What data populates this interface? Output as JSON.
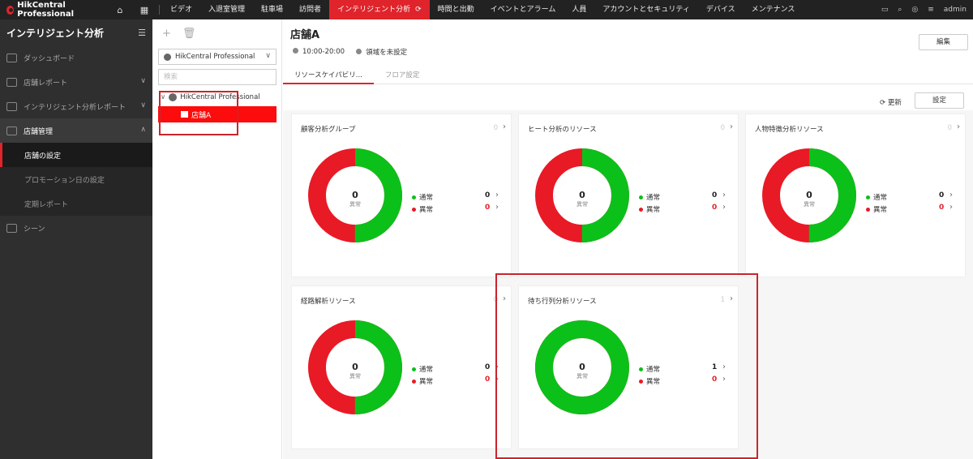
{
  "app": {
    "name": "HikCentral Professional",
    "user": "admin"
  },
  "nav": [
    "ビデオ",
    "入退室管理",
    "駐車場",
    "訪問者",
    "インテリジェント分析",
    "時間と出勤",
    "イベントとアラーム",
    "人員",
    "アカウントとセキュリティ",
    "デバイス",
    "メンテナンス"
  ],
  "nav_active_index": 4,
  "sidebar": {
    "title": "インテリジェント分析",
    "items": [
      {
        "label": "ダッシュボード"
      },
      {
        "label": "店舗レポート"
      },
      {
        "label": "インテリジェント分析レポート"
      },
      {
        "label": "店舗管理"
      },
      {
        "label": "シーン"
      }
    ],
    "sub_items": [
      {
        "label": "店舗の設定"
      },
      {
        "label": "プロモーション日の設定"
      },
      {
        "label": "定期レポート"
      }
    ]
  },
  "tree": {
    "select_value": "HikCentral Professional",
    "search_placeholder": "検索",
    "root": "HikCentral Professional",
    "child": "店舗A"
  },
  "store": {
    "name": "店舗A",
    "hours": "10:00-20:00",
    "area": "領域を未設定",
    "edit_label": "編集",
    "refresh_label": "更新",
    "settings_label": "設定"
  },
  "tabs": [
    "リソースケイパビリ...",
    "フロア設定"
  ],
  "legend": {
    "normal": "通常",
    "abnormal": "異常",
    "center_label": "異常"
  },
  "cards": [
    {
      "title": "顧客分析グループ",
      "count": "0",
      "center": "0",
      "normal": "0",
      "abnormal": "0"
    },
    {
      "title": "ヒート分析のリソース",
      "count": "0",
      "center": "0",
      "normal": "0",
      "abnormal": "0"
    },
    {
      "title": "人物特徴分析リソース",
      "count": "0",
      "center": "0",
      "normal": "0",
      "abnormal": "0"
    },
    {
      "title": "経路解析リソース",
      "count": "0",
      "center": "0",
      "normal": "0",
      "abnormal": "0"
    },
    {
      "title": "待ち行列分析リソース",
      "count": "1",
      "center": "0",
      "normal": "1",
      "abnormal": "0"
    }
  ],
  "colors": {
    "accent": "#e0242b",
    "normal": "#0cc01a",
    "abnormal": "#e81a26"
  }
}
